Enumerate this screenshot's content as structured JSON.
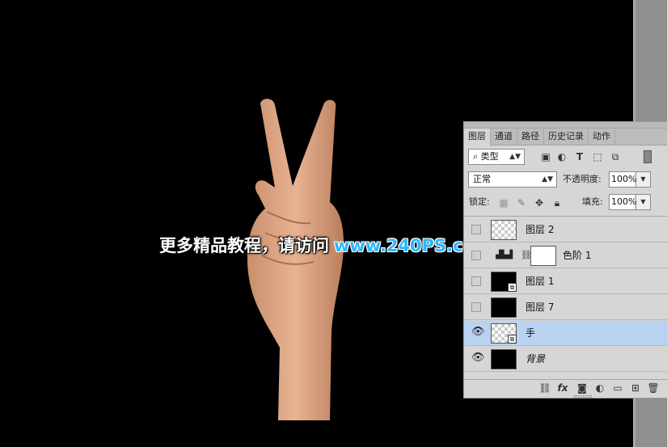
{
  "watermark": {
    "text_cn": "更多精品教程，请访问",
    "url": "www.240PS.com"
  },
  "panel": {
    "tabs": [
      "图层",
      "通道",
      "路径",
      "历史记录",
      "动作"
    ],
    "filter": {
      "value": "类型",
      "icons": [
        "image-filter-icon",
        "adjustment-filter-icon",
        "type-filter-icon",
        "shape-filter-icon",
        "smart-object-filter-icon"
      ],
      "type_glyph": "T"
    },
    "blend_mode": "正常",
    "opacity": {
      "label": "不透明度:",
      "value": "100%"
    },
    "lock": {
      "label": "锁定:"
    },
    "fill": {
      "label": "填充:",
      "value": "100%"
    },
    "layers": [
      {
        "name": "图层 2",
        "visible": false,
        "thumb": "checker",
        "selected": false
      },
      {
        "name": "色阶 1",
        "visible": false,
        "thumb": "adjustment",
        "selected": false
      },
      {
        "name": "图层 1",
        "visible": false,
        "thumb": "black-smart",
        "selected": false
      },
      {
        "name": "图层 7",
        "visible": false,
        "thumb": "black",
        "selected": false
      },
      {
        "name": "手",
        "visible": true,
        "thumb": "checker-smart",
        "selected": true
      },
      {
        "name": "背景",
        "visible": true,
        "thumb": "black",
        "selected": false,
        "italic": true
      }
    ],
    "footer_fx": "fx"
  }
}
